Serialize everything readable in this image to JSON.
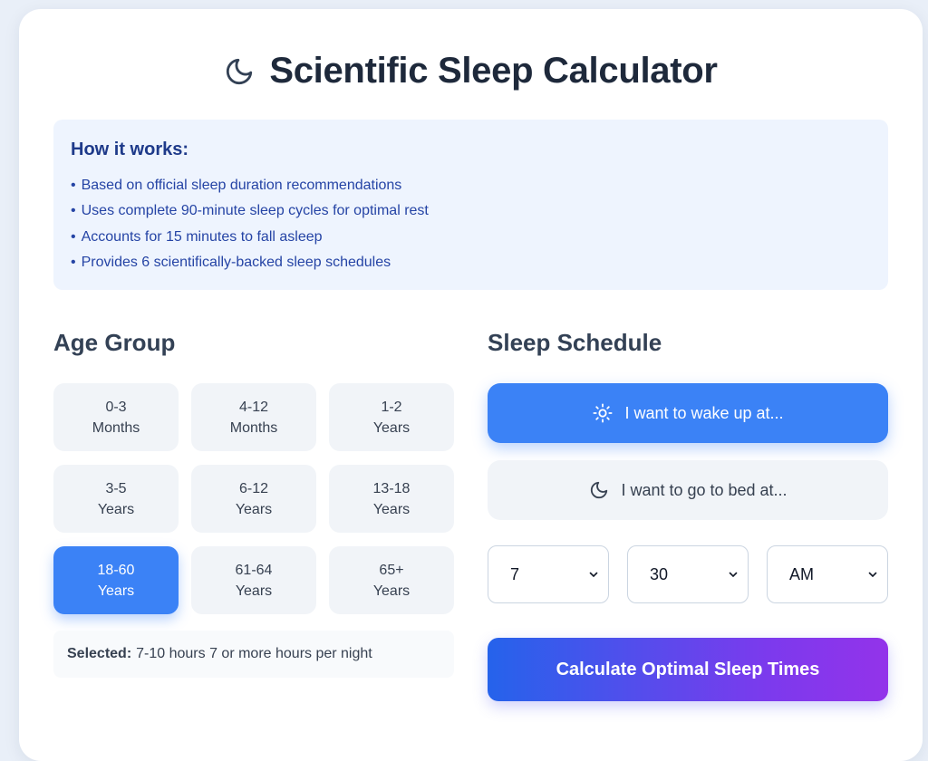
{
  "header": {
    "title": "Scientific Sleep Calculator",
    "icon": "moon-icon"
  },
  "info": {
    "title": "How it works:",
    "items": [
      "Based on official sleep duration recommendations",
      "Uses complete 90-minute sleep cycles for optimal rest",
      "Accounts for 15 minutes to fall asleep",
      "Provides 6 scientifically-backed sleep schedules"
    ]
  },
  "age_group": {
    "title": "Age Group",
    "options": [
      {
        "line1": "0-3",
        "line2": "Months"
      },
      {
        "line1": "4-12",
        "line2": "Months"
      },
      {
        "line1": "1-2",
        "line2": "Years"
      },
      {
        "line1": "3-5",
        "line2": "Years"
      },
      {
        "line1": "6-12",
        "line2": "Years"
      },
      {
        "line1": "13-18",
        "line2": "Years"
      },
      {
        "line1": "18-60",
        "line2": "Years"
      },
      {
        "line1": "61-64",
        "line2": "Years"
      },
      {
        "line1": "65+",
        "line2": "Years"
      }
    ],
    "selected_index": 6,
    "selected_label": "Selected:",
    "selected_text": "7-10 hours 7 or more hours per night"
  },
  "schedule": {
    "title": "Sleep Schedule",
    "wake_label": "I want to wake up at...",
    "wake_icon": "sun-icon",
    "bed_label": "I want to go to bed at...",
    "bed_icon": "moon-icon",
    "active_mode": "wake",
    "hour": "7",
    "minute": "30",
    "ampm": "AM",
    "calculate_label": "Calculate Optimal Sleep Times"
  },
  "colors": {
    "accent": "#3b82f6",
    "gradient_start": "#2563eb",
    "gradient_end": "#9333ea",
    "info_bg": "#eef4fe"
  }
}
